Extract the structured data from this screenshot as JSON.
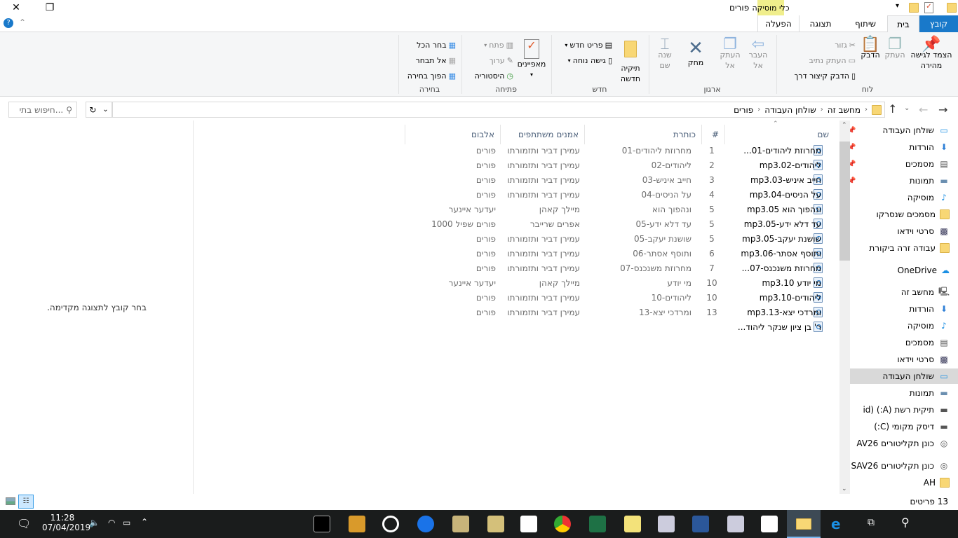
{
  "window": {
    "title": "פורים",
    "contextual_tab": "כלי מוסיקה"
  },
  "tabs": [
    {
      "label": "קובץ"
    },
    {
      "label": "בית"
    },
    {
      "label": "שיתוף"
    },
    {
      "label": "תצוגה"
    },
    {
      "label": "הפעלה"
    }
  ],
  "ribbon": {
    "clipboard": {
      "label": "לוח",
      "pin": "הצמד לגישה מהירה",
      "copy": "העתק",
      "paste": "הדבק",
      "cut": "גזור",
      "copy_path": "העתק נתיב",
      "paste_shortcut": "הדבק קיצור דרך"
    },
    "organize": {
      "label": "ארגון",
      "move_to": "העבר אל",
      "copy_to": "העתק אל",
      "delete": "מחק",
      "rename": "שנה שם"
    },
    "new": {
      "label": "חדש",
      "new_folder": "תיקיה חדשה",
      "new_item": "פריט חדש",
      "easy_access": "גישה נוחה"
    },
    "open": {
      "label": "פתיחה",
      "properties": "מאפיינים",
      "open": "פתח",
      "edit": "ערוך",
      "history": "היסטוריה"
    },
    "select": {
      "label": "בחירה",
      "select_all": "בחר הכל",
      "select_none": "אל תבחר",
      "invert": "הפוך בחירה"
    }
  },
  "address": {
    "crumbs": [
      "מחשב זה",
      "שולחן העבודה",
      "פורים"
    ],
    "search_placeholder": "חיפוש בתי..."
  },
  "nav": {
    "quick": [
      {
        "label": "שולחן העבודה",
        "icon": "desktop-icon",
        "pinned": true
      },
      {
        "label": "הורדות",
        "icon": "download-icon",
        "pinned": true
      },
      {
        "label": "מסמכים",
        "icon": "documents-icon",
        "pinned": true
      },
      {
        "label": "תמונות",
        "icon": "pictures-icon",
        "pinned": true
      },
      {
        "label": "מוסיקה",
        "icon": "music-icon"
      },
      {
        "label": "מסמכים שנסרקו",
        "icon": "folder-icon"
      },
      {
        "label": "סרטי וידאו",
        "icon": "video-icon"
      },
      {
        "label": "עבודה זרה ביקורת",
        "icon": "folder-icon"
      }
    ],
    "onedrive": "OneDrive",
    "pc": [
      {
        "label": "מחשב זה",
        "icon": "computer-icon"
      },
      {
        "label": "הורדות",
        "icon": "download-icon"
      },
      {
        "label": "מוסיקה",
        "icon": "music-icon"
      },
      {
        "label": "מסמכים",
        "icon": "documents-icon"
      },
      {
        "label": "סרטי וידאו",
        "icon": "video-icon"
      },
      {
        "label": "שולחן העבודה",
        "icon": "desktop-icon",
        "selected": true
      },
      {
        "label": "תמונות",
        "icon": "pictures-icon"
      },
      {
        "label": "תיקית רשת (A:) (id",
        "icon": "network-drive-icon"
      },
      {
        "label": "דיסק מקומי (C:)",
        "icon": "local-disk-icon"
      },
      {
        "label": "כונן תקליטורים AV26",
        "icon": "cd-drive-icon"
      }
    ],
    "extra": [
      {
        "label": "כונן תקליטורים SAV26",
        "icon": "cd-drive-icon"
      },
      {
        "label": "AH",
        "icon": "folder-icon"
      }
    ]
  },
  "columns": {
    "name": "שם",
    "number": "#",
    "title": "כותרת",
    "artists": "אמנים משתתפים",
    "album": "אלבום"
  },
  "files": [
    {
      "name": "מחרוזת ליהודים-01...",
      "num": "1",
      "title": "מחרוזת ליהודים-01",
      "artist": "עמירן דביר ותזמורתו",
      "album": "פורים"
    },
    {
      "name": "ליהודים-02.mp3",
      "num": "2",
      "title": "ליהודים-02",
      "artist": "עמירן דביר ותזמורתו",
      "album": "פורים"
    },
    {
      "name": "חייב איניש-03.mp3",
      "num": "3",
      "title": "חייב איניש-03",
      "artist": "עמירן דביר ותזמורתו",
      "album": "פורים"
    },
    {
      "name": "על הניסים-04.mp3",
      "num": "4",
      "title": "על הניסים-04",
      "artist": "עמירן דביר ותזמורתו",
      "album": "פורים"
    },
    {
      "name": "ונהפוך הוא 05.mp3",
      "num": "5",
      "title": "ונהפוך הוא",
      "artist": "מיילך קאהן",
      "album": "יעדער איינער"
    },
    {
      "name": "עד דלא ידע-05.mp3",
      "num": "5",
      "title": "עד דלא ידע-05",
      "artist": "אפרים שרייבר",
      "album": "פורים שפיל 1000"
    },
    {
      "name": "שושנת יעקב-05.mp3",
      "num": "5",
      "title": "שושנת יעקב-05",
      "artist": "עמירן דביר ותזמורתו",
      "album": "פורים"
    },
    {
      "name": "ותוסף אסתר-06.mp3",
      "num": "6",
      "title": "ותוסף אסתר-06",
      "artist": "עמירן דביר ותזמורתו",
      "album": "פורים"
    },
    {
      "name": "מחרוזת משנכנס-07...",
      "num": "7",
      "title": "מחרוזת משנכנס-07",
      "artist": "עמירן דביר ותזמורתו",
      "album": "פורים"
    },
    {
      "name": "מי יודע 10.mp3",
      "num": "10",
      "title": "מי יודע",
      "artist": "מיילך קאהן",
      "album": "יעדער איינער"
    },
    {
      "name": "ליהודים-10.mp3",
      "num": "10",
      "title": "ליהודים-10",
      "artist": "עמירן דביר ותזמורתו",
      "album": "פורים"
    },
    {
      "name": "ומרדכי יצא-13.mp3",
      "num": "13",
      "title": "ומרדכי יצא-13",
      "artist": "עמירן דביר ותזמורתו",
      "album": "פורים"
    },
    {
      "name": "ר' בן ציון שנקר ליהוד...",
      "num": "",
      "title": "",
      "artist": "",
      "album": ""
    }
  ],
  "preview": {
    "empty_text": "בחר קובץ לתצוגה מקדימה."
  },
  "status": {
    "count": "13 פריטים"
  },
  "taskbar": {
    "time": "11:28",
    "date": "07/04/2019"
  }
}
